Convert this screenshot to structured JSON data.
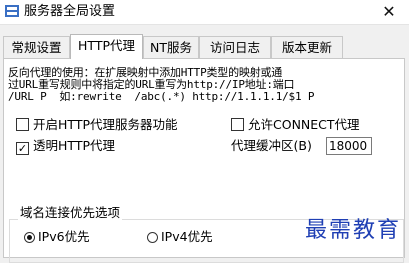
{
  "window": {
    "title": "服务器全局设置",
    "close_glyph": "✕"
  },
  "tabs": [
    {
      "label": "常规设置",
      "active": false
    },
    {
      "label": "HTTP代理",
      "active": true
    },
    {
      "label": "NT服务",
      "active": false
    },
    {
      "label": "访问日志",
      "active": false
    },
    {
      "label": "版本更新",
      "active": false
    }
  ],
  "http_proxy": {
    "description_lines": [
      "反向代理的使用：在扩展映射中添加HTTP类型的映射或通",
      "过URL重写规则中将指定的URL重写为http://IP地址:端口",
      "/URL P  如:rewrite  /abc(.*) http://1.1.1.1/$1 P"
    ],
    "enable_server": {
      "label": "开启HTTP代理服务器功能",
      "checked": false
    },
    "allow_connect": {
      "label": "允许CONNECT代理",
      "checked": false
    },
    "transparent": {
      "label": "透明HTTP代理",
      "checked": true
    },
    "cache": {
      "label": "代理缓冲区(B)",
      "value": "18000"
    }
  },
  "dns_priority": {
    "group_label": "域名连接优先选项",
    "options": [
      {
        "label": "IPv6优先",
        "selected": true
      },
      {
        "label": "IPv4优先",
        "selected": false
      }
    ]
  },
  "watermark": "最需教育",
  "colors": {
    "watermark": "#1f3fb4",
    "background": "#f0f0f0",
    "panel": "#ffffff"
  }
}
